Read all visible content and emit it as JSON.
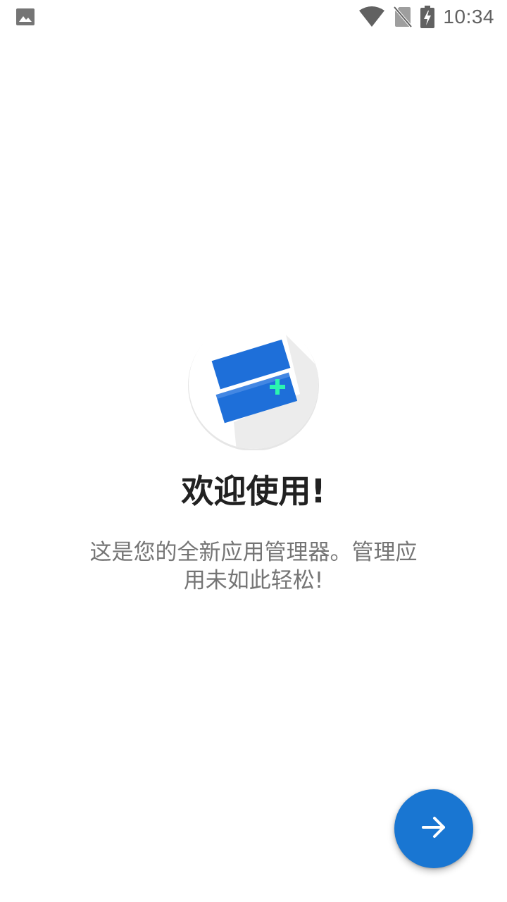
{
  "status_bar": {
    "time": "10:34",
    "icons": [
      "image-icon",
      "wifi-icon",
      "no-sim-icon",
      "battery-charging-icon"
    ]
  },
  "welcome": {
    "logo_icon": "app-manager-logo-icon",
    "title": "欢迎使用!",
    "subtitle": "这是您的全新应用管理器。管理应用未如此轻松!"
  },
  "fab": {
    "icon": "arrow-forward-icon"
  },
  "colors": {
    "accent": "#1976d2",
    "logo_blue": "#1e6fd9",
    "logo_plus": "#2bf5b0"
  }
}
